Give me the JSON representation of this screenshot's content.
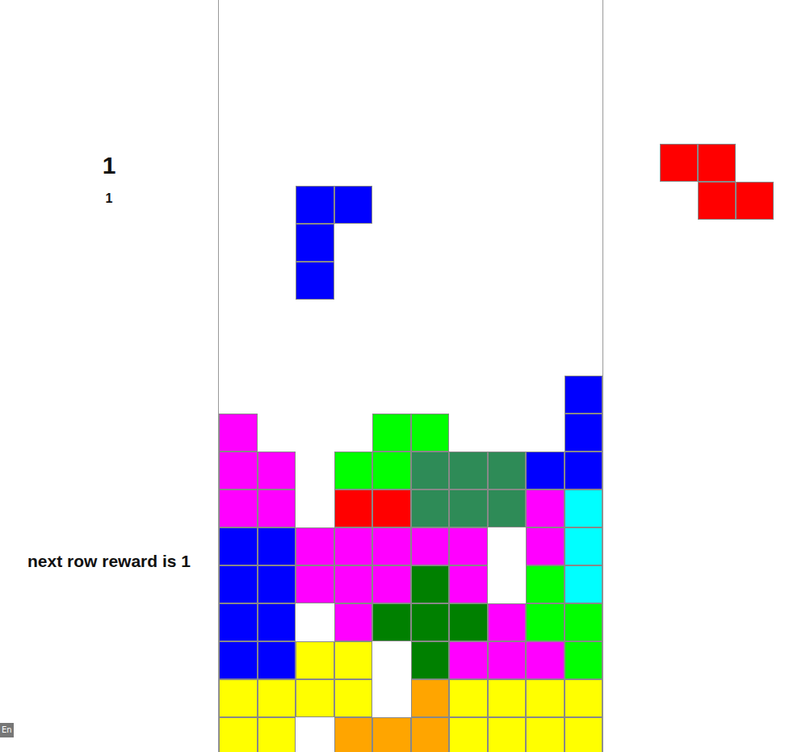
{
  "score": "1",
  "level": "1",
  "reward_label": "next row reward is 1",
  "language_badge": "En",
  "board": {
    "rows": [
      [
        "",
        "",
        "",
        "",
        "",
        "",
        "",
        "",
        "",
        ""
      ],
      [
        "",
        "",
        "",
        "",
        "",
        "",
        "",
        "",
        "",
        ""
      ],
      [
        "",
        "",
        "",
        "",
        "",
        "",
        "",
        "",
        "",
        ""
      ],
      [
        "",
        "",
        "",
        "",
        "",
        "",
        "",
        "",
        "",
        ""
      ],
      [
        "",
        "",
        "",
        "",
        "",
        "",
        "",
        "",
        "",
        ""
      ],
      [
        "",
        "",
        "",
        "",
        "",
        "",
        "",
        "",
        "",
        ""
      ],
      [
        "",
        "",
        "",
        "",
        "",
        "",
        "",
        "",
        "",
        ""
      ],
      [
        "",
        "",
        "",
        "",
        "",
        "",
        "",
        "",
        "",
        ""
      ],
      [
        "",
        "",
        "",
        "",
        "",
        "",
        "",
        "",
        "",
        ""
      ],
      [
        "",
        "",
        "",
        "",
        "",
        "",
        "",
        "",
        "",
        ""
      ],
      [
        "",
        "",
        "",
        "",
        "",
        "",
        "",
        "",
        "",
        "#0000ff"
      ],
      [
        "#ff00ff",
        "",
        "",
        "",
        "#00ff00",
        "#00ff00",
        "",
        "",
        "",
        "#0000ff"
      ],
      [
        "#ff00ff",
        "#ff00ff",
        "",
        "#00ff00",
        "#00ff00",
        "#2e8b57",
        "#2e8b57",
        "#2e8b57",
        "#0000ff",
        "#0000ff"
      ],
      [
        "#ff00ff",
        "#ff00ff",
        "",
        "#ff0000",
        "#ff0000",
        "#2e8b57",
        "#2e8b57",
        "#2e8b57",
        "#ff00ff",
        "#00ffff"
      ],
      [
        "#0000ff",
        "#0000ff",
        "#ff00ff",
        "#ff00ff",
        "#ff00ff",
        "#ff00ff",
        "#ff00ff",
        "",
        "#ff00ff",
        "#00ffff"
      ],
      [
        "#0000ff",
        "#0000ff",
        "#ff00ff",
        "#ff00ff",
        "#ff00ff",
        "#008000",
        "#ff00ff",
        "",
        "#00ff00",
        "#00ffff"
      ],
      [
        "#0000ff",
        "#0000ff",
        "",
        "#ff00ff",
        "#008000",
        "#008000",
        "#008000",
        "#ff00ff",
        "#00ff00",
        "#00ff00"
      ],
      [
        "#0000ff",
        "#0000ff",
        "#ffff00",
        "#ffff00",
        "",
        "#008000",
        "#ff00ff",
        "#ff00ff",
        "#ff00ff",
        "#00ff00"
      ],
      [
        "#ffff00",
        "#ffff00",
        "#ffff00",
        "#ffff00",
        "",
        "#ffa500",
        "#ffff00",
        "#ffff00",
        "#ffff00",
        "#ffff00"
      ],
      [
        "#ffff00",
        "#ffff00",
        "",
        "#ffa500",
        "#ffa500",
        "#ffa500",
        "#ffff00",
        "#ffff00",
        "#ffff00",
        "#ffff00"
      ]
    ]
  },
  "falling_piece": {
    "color": "#0000ff",
    "cells": [
      [
        5,
        2
      ],
      [
        5,
        3
      ],
      [
        6,
        2
      ],
      [
        7,
        2
      ]
    ]
  },
  "next_piece": {
    "color": "#ff0000",
    "shape": [
      [
        1,
        1,
        0
      ],
      [
        0,
        1,
        1
      ]
    ]
  }
}
